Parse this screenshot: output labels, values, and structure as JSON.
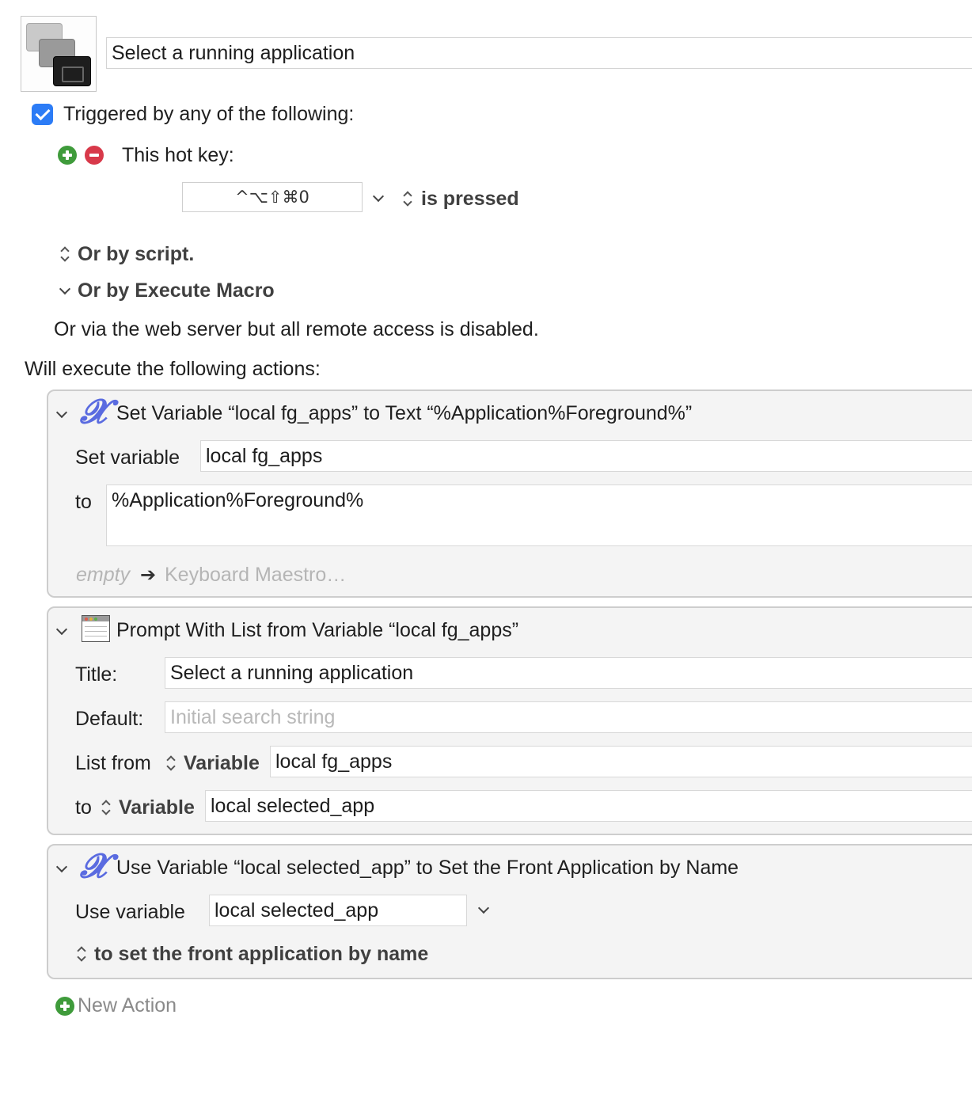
{
  "macro": {
    "icon": "stacked-windows-icon",
    "name": "Select a running application"
  },
  "triggers": {
    "enabled": true,
    "heading": "Triggered by any of the following:",
    "hotkey_label": "This hot key:",
    "hotkey_value": "^⌥⇧⌘0",
    "hotkey_condition": "is pressed",
    "or_by_script": "Or by script.",
    "or_by_execute_macro": "Or by Execute Macro",
    "web_server_note": "Or via the web server but all remote access is disabled."
  },
  "actions_heading": "Will execute the following actions:",
  "actions": [
    {
      "title": "Set Variable “local fg_apps” to Text “%Application%Foreground%”",
      "icon": "variable-x-icon",
      "var_label": "Set variable",
      "var_value": "local fg_apps",
      "to_label": "to",
      "to_value": "%Application%Foreground%",
      "result_empty": "empty",
      "result_target": "Keyboard Maestro…"
    },
    {
      "title": "Prompt With List from Variable “local fg_apps”",
      "icon": "window-list-icon",
      "title_label": "Title:",
      "title_value": "Select a running application",
      "default_label": "Default:",
      "default_placeholder": "Initial search string",
      "list_from_label": "List from",
      "list_from_type": "Variable",
      "list_from_value": "local fg_apps",
      "to_label": "to",
      "to_type": "Variable",
      "to_value": "local selected_app"
    },
    {
      "title": "Use Variable “local selected_app” to Set the Front Application by Name",
      "icon": "variable-x-icon",
      "use_label": "Use variable",
      "use_value": "local selected_app",
      "mode": "to set the front application by name"
    }
  ],
  "new_action": "New Action",
  "colors": {
    "checkbox": "#2c7cf6",
    "add": "#3f9b3b",
    "remove": "#d8394a",
    "variable_icon": "#5a6be0"
  }
}
